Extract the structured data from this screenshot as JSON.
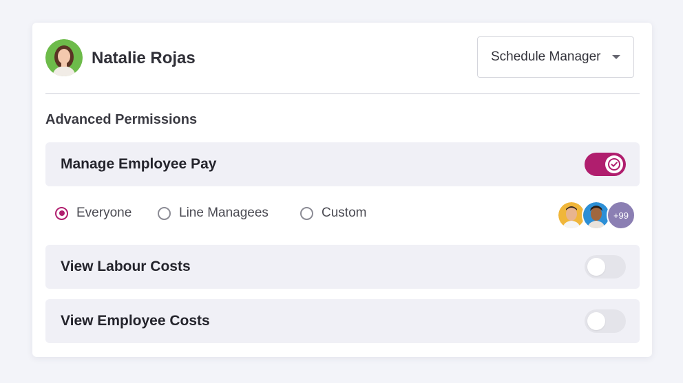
{
  "user": {
    "name": "Natalie Rojas",
    "role": "Schedule Manager"
  },
  "section_title": "Advanced Permissions",
  "permissions": [
    {
      "label": "Manage Employee Pay",
      "enabled": true
    },
    {
      "label": "View Labour Costs",
      "enabled": false
    },
    {
      "label": "View Employee Costs",
      "enabled": false
    }
  ],
  "scope": {
    "options": [
      "Everyone",
      "Line Managees",
      "Custom"
    ],
    "selected": "Everyone"
  },
  "assignees": {
    "extra_count": "+99"
  },
  "colors": {
    "accent": "#b01e6e",
    "badge": "#8b7fb3",
    "row_bg": "#f0f0f6"
  },
  "icons": [
    "check-icon",
    "chevron-down-icon"
  ]
}
